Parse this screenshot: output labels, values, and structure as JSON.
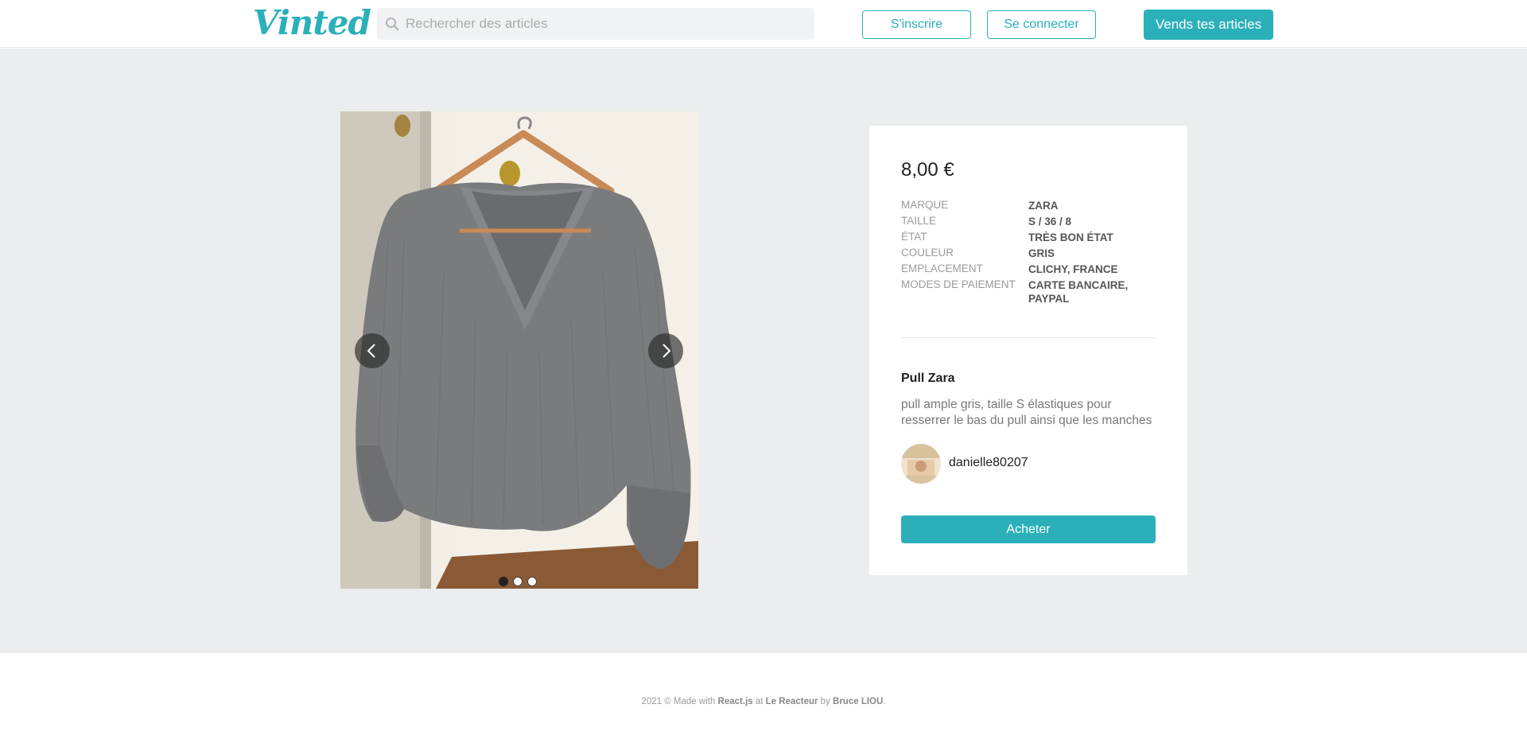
{
  "header": {
    "logo": "Vinted",
    "search_placeholder": "Rechercher des articles",
    "signup_label": "S'inscrire",
    "login_label": "Se connecter",
    "sell_label": "Vends tes articles"
  },
  "carousel": {
    "slide_count": 3,
    "active_slide": 1
  },
  "product": {
    "price": "8,00 €",
    "details": [
      {
        "label": "MARQUE",
        "value": "ZARA"
      },
      {
        "label": "TAILLE",
        "value": "S / 36 / 8"
      },
      {
        "label": "ÉTAT",
        "value": "TRÈS BON ÉTAT"
      },
      {
        "label": "COULEUR",
        "value": "GRIS"
      },
      {
        "label": "EMPLACEMENT",
        "value": "CLICHY, FRANCE"
      },
      {
        "label": "MODES DE PAIEMENT",
        "value": "CARTE BANCAIRE, PAYPAL"
      }
    ],
    "title": "Pull Zara",
    "description": "pull ample gris, taille S élastiques pour resserrer le bas du pull ainsi que les manches",
    "seller": "danielle80207",
    "buy_label": "Acheter"
  },
  "footer": {
    "prefix": "2021 © Made with ",
    "tech": "React.js",
    "middle": " at ",
    "school": "Le Reacteur",
    "by": " by ",
    "author": "Bruce LIOU",
    "suffix": "."
  },
  "colors": {
    "accent": "#2bb0b9",
    "page_background": "#ebedee",
    "sweater": "#7a7b7d"
  },
  "icons": {
    "search": "search-icon",
    "prev": "chevron-left-icon",
    "next": "chevron-right-icon"
  }
}
